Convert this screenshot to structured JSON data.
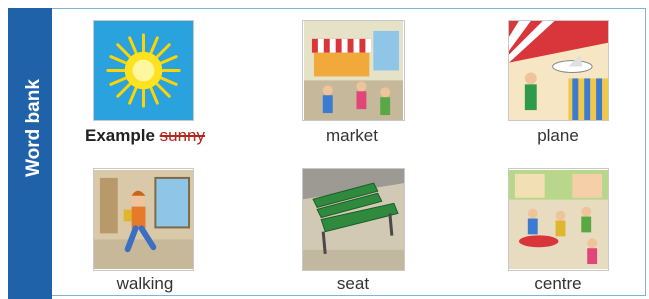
{
  "title": "Word bank",
  "example": {
    "label": "Example",
    "word": "sunny"
  },
  "words": [
    "market",
    "plane",
    "walking",
    "seat",
    "centre"
  ],
  "icons": [
    "sun-picture",
    "market-picture",
    "plane-picture",
    "walking-picture",
    "seat-picture",
    "centre-picture"
  ],
  "colors": {
    "tab": "#1f62aa",
    "border": "#7fb3d9",
    "strike": "#b2271f",
    "sky": "#2aa2dd",
    "sun": "#ffe21f"
  }
}
